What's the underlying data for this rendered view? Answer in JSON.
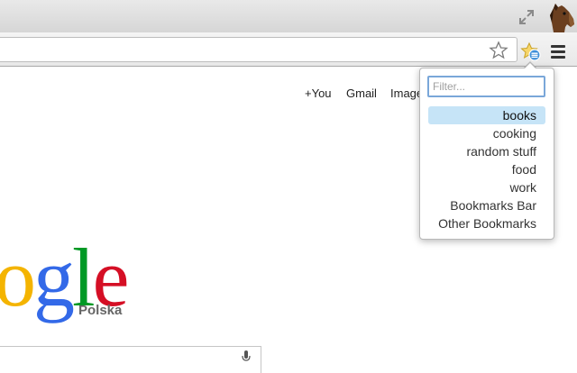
{
  "page": {
    "nav": {
      "you": "+You",
      "gmail": "Gmail",
      "images": "Images"
    },
    "logo": {
      "letters": [
        "o",
        "g",
        "l",
        "e"
      ],
      "region": "Polska"
    }
  },
  "popup": {
    "filter_placeholder": "Filter...",
    "folders": [
      {
        "label": "books",
        "selected": true
      },
      {
        "label": "cooking",
        "selected": false
      },
      {
        "label": "random stuff",
        "selected": false
      },
      {
        "label": "food",
        "selected": false
      },
      {
        "label": "work",
        "selected": false
      },
      {
        "label": "Bookmarks Bar",
        "selected": false
      },
      {
        "label": "Other Bookmarks",
        "selected": false
      }
    ]
  },
  "icons": {
    "fullscreen": "fullscreen-icon",
    "avatar": "horse-avatar",
    "star": "star-icon",
    "extension": "bookmark-extension-icon",
    "menu": "hamburger-menu-icon",
    "mic": "microphone-icon"
  },
  "colors": {
    "selection": "#c6e4f7",
    "filter_border": "#7aa7d9",
    "google_yellow": "#f4b400",
    "google_blue": "#3369e8",
    "google_green": "#009925",
    "google_red": "#d50f25"
  }
}
